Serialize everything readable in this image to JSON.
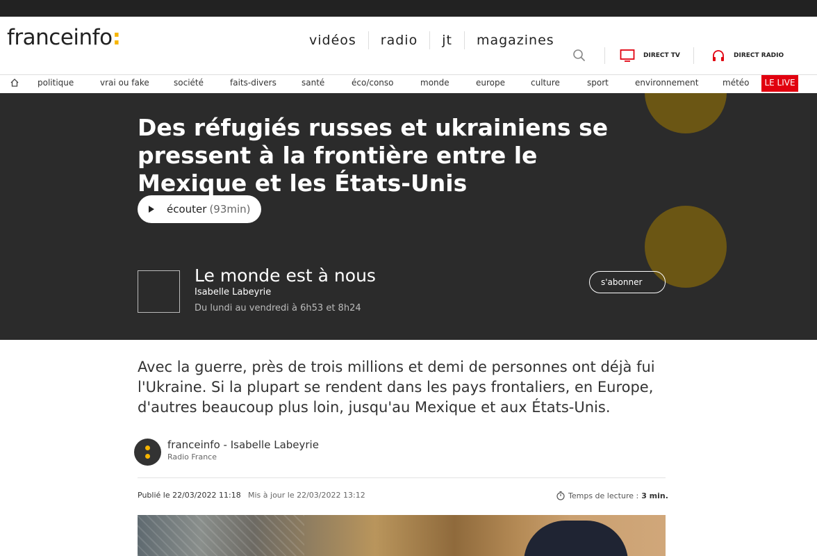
{
  "header": {
    "logo_text": "franceinfo",
    "logo_colon": ":",
    "main_nav": [
      "vidéos",
      "radio",
      "jt",
      "magazines"
    ],
    "direct_tv": "DIRECT TV",
    "direct_radio": "DIRECT RADIO"
  },
  "subnav": {
    "items": [
      "politique",
      "vrai ou fake",
      "société",
      "faits-divers",
      "santé",
      "éco/conso",
      "monde",
      "europe",
      "culture",
      "sport",
      "environnement",
      "météo"
    ],
    "live": "LE LIVE"
  },
  "hero": {
    "headline": "Des réfugiés russes et ukrainiens se pressent à la frontière entre le Mexique et les États-Unis",
    "listen_label": "écouter",
    "listen_duration": "(93min)",
    "show_title": "Le monde est à nous",
    "show_host": "Isabelle Labeyrie",
    "show_schedule": "Du lundi au vendredi à 6h53 et 8h24",
    "subscribe": "s'abonner"
  },
  "article": {
    "lede": "Avec la guerre, près de trois millions et demi de personnes ont déjà fui l'Ukraine. Si la plupart se rendent dans les pays frontaliers, en Europe, d'autres beaucoup plus loin, jusqu'au Mexique et aux États-Unis.",
    "author": "franceinfo - Isabelle Labeyrie",
    "author_org": "Radio France",
    "published": "Publié le 22/03/2022 11:18",
    "updated": "Mis à jour le 22/03/2022 13:12",
    "reading_label": "Temps de lecture :",
    "reading_time": "3 min."
  },
  "colors": {
    "accent": "#f7b500",
    "live_red": "#e1000f",
    "hero_bg": "#2b2b2b"
  },
  "icons": [
    "search-icon",
    "tv-icon",
    "headphones-icon",
    "home-icon",
    "play-icon",
    "stopwatch-icon"
  ]
}
